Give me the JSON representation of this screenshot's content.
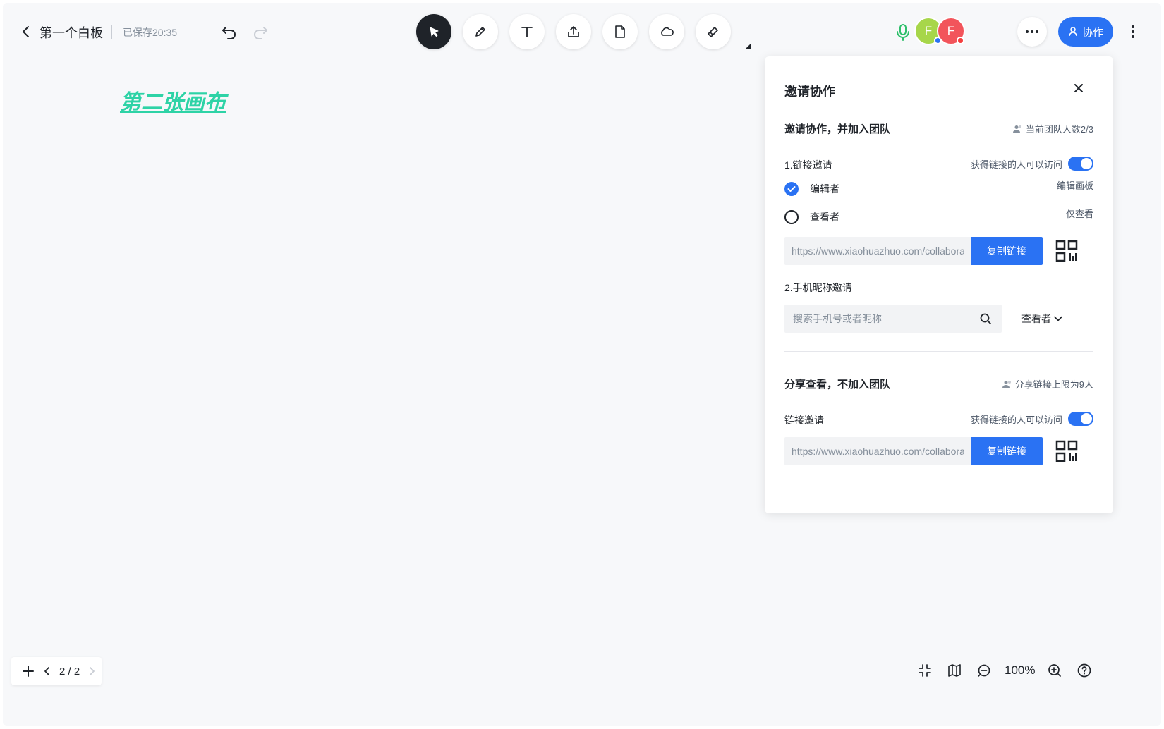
{
  "header": {
    "doc_title": "第一个白板",
    "save_status": "已保存20:35",
    "collab_label": "协作"
  },
  "avatars": [
    {
      "initial": "F",
      "color": "#a7d64a",
      "dot_color": "#2a72f3"
    },
    {
      "initial": "F",
      "color": "#f2545b",
      "dot_color": "#f53f3f"
    }
  ],
  "toolbar": {
    "tools": [
      "select-icon",
      "pen-icon",
      "text-icon",
      "upload-icon",
      "file-icon",
      "shape-icon",
      "eraser-icon"
    ],
    "active_tool": "select-icon"
  },
  "canvas": {
    "text": "第二张画布",
    "text_color": "#2ed3a6"
  },
  "panel": {
    "title": "邀请协作",
    "team_section": {
      "title": "邀请协作，并加入团队",
      "member_count": "当前团队人数2/3",
      "link_invite_label": "1.链接邀请",
      "access_toggle_label": "获得链接的人可以访问",
      "access_toggle_on": true,
      "roles": [
        {
          "label": "编辑者",
          "hint": "编辑画板",
          "checked": true
        },
        {
          "label": "查看者",
          "hint": "仅查看",
          "checked": false
        }
      ],
      "link_value": "https://www.xiaohuazhuo.com/collaborate",
      "copy_label": "复制链接",
      "phone_invite_label": "2.手机昵称邀请",
      "search_placeholder": "搜索手机号或者昵称",
      "role_select_value": "查看者"
    },
    "share_section": {
      "title": "分享查看，不加入团队",
      "limit_note": "分享链接上限为9人",
      "link_invite_label": "链接邀请",
      "access_toggle_label": "获得链接的人可以访问",
      "access_toggle_on": true,
      "link_value": "https://www.xiaohuazhuo.com/collaborate",
      "copy_label": "复制链接"
    }
  },
  "footer": {
    "page_indicator": "2 / 2",
    "zoom": "100%"
  },
  "colors": {
    "accent": "#2a72f3",
    "background": "#f7f8fa"
  }
}
